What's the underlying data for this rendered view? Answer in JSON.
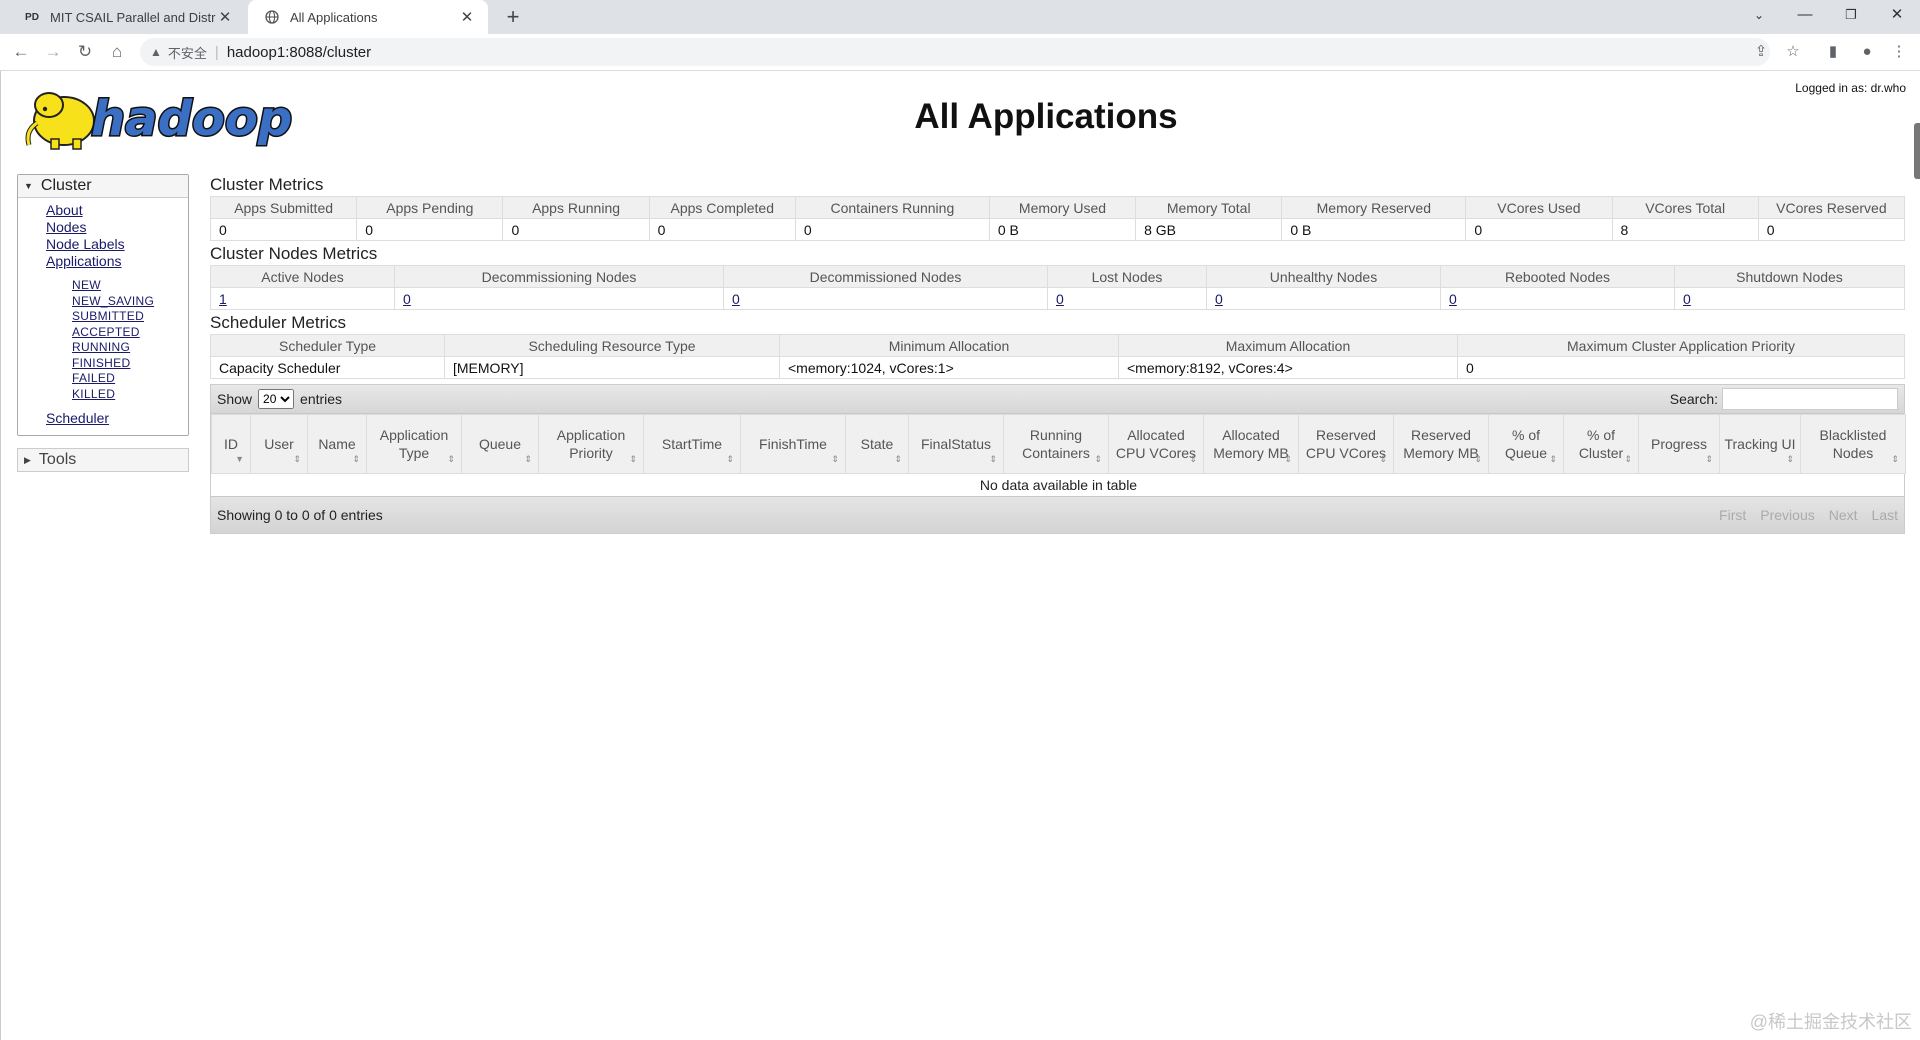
{
  "browser": {
    "tabs": [
      {
        "title": "MIT CSAIL Parallel and Distrib",
        "favicon": "PD"
      },
      {
        "title": "All Applications",
        "favicon": "globe-icon"
      }
    ],
    "security_label": "不安全",
    "url": "hadoop1:8088/cluster"
  },
  "page": {
    "title": "All Applications",
    "logged_in": "Logged in as: dr.who",
    "logo_text": "hadoop"
  },
  "sidebar": {
    "cluster_label": "Cluster",
    "links": [
      "About",
      "Nodes",
      "Node Labels",
      "Applications"
    ],
    "app_states": [
      "NEW",
      "NEW_SAVING",
      "SUBMITTED",
      "ACCEPTED",
      "RUNNING",
      "FINISHED",
      "FAILED",
      "KILLED"
    ],
    "scheduler": "Scheduler",
    "tools_label": "Tools"
  },
  "cluster_metrics": {
    "title": "Cluster Metrics",
    "headers": [
      "Apps Submitted",
      "Apps Pending",
      "Apps Running",
      "Apps Completed",
      "Containers Running",
      "Memory Used",
      "Memory Total",
      "Memory Reserved",
      "VCores Used",
      "VCores Total",
      "VCores Reserved"
    ],
    "values": [
      "0",
      "0",
      "0",
      "0",
      "0",
      "0 B",
      "8 GB",
      "0 B",
      "0",
      "8",
      "0"
    ]
  },
  "nodes_metrics": {
    "title": "Cluster Nodes Metrics",
    "headers": [
      "Active Nodes",
      "Decommissioning Nodes",
      "Decommissioned Nodes",
      "Lost Nodes",
      "Unhealthy Nodes",
      "Rebooted Nodes",
      "Shutdown Nodes"
    ],
    "values": [
      "1",
      "0",
      "0",
      "0",
      "0",
      "0",
      "0"
    ]
  },
  "scheduler_metrics": {
    "title": "Scheduler Metrics",
    "headers": [
      "Scheduler Type",
      "Scheduling Resource Type",
      "Minimum Allocation",
      "Maximum Allocation",
      "Maximum Cluster Application Priority"
    ],
    "values": [
      "Capacity Scheduler",
      "[MEMORY]",
      "<memory:1024, vCores:1>",
      "<memory:8192, vCores:4>",
      "0"
    ]
  },
  "apps_table": {
    "show_label": "Show",
    "entries_value": "20",
    "entries_label": "entries",
    "search_label": "Search:",
    "search_value": "",
    "columns": [
      "ID",
      "User",
      "Name",
      "Application Type",
      "Queue",
      "Application Priority",
      "StartTime",
      "FinishTime",
      "State",
      "FinalStatus",
      "Running Containers",
      "Allocated CPU VCores",
      "Allocated Memory MB",
      "Reserved CPU VCores",
      "Reserved Memory MB",
      "% of Queue",
      "% of Cluster",
      "Progress",
      "Tracking UI",
      "Blacklisted Nodes"
    ],
    "empty_message": "No data available in table",
    "footer_info": "Showing 0 to 0 of 0 entries",
    "pagination": [
      "First",
      "Previous",
      "Next",
      "Last"
    ]
  },
  "watermark": "@稀土掘金技术社区"
}
